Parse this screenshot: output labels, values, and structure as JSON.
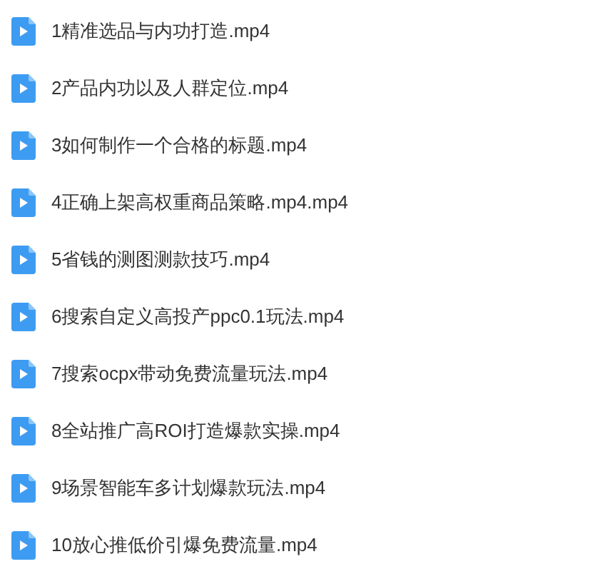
{
  "files": [
    {
      "name": "1精准选品与内功打造.mp4"
    },
    {
      "name": "2产品内功以及人群定位.mp4"
    },
    {
      "name": "3如何制作一个合格的标题.mp4"
    },
    {
      "name": "4正确上架高权重商品策略.mp4.mp4"
    },
    {
      "name": "5省钱的测图测款技巧.mp4"
    },
    {
      "name": "6搜索自定义高投产ppc0.1玩法.mp4"
    },
    {
      "name": "7搜索ocpx带动免费流量玩法.mp4"
    },
    {
      "name": "8全站推广高ROI打造爆款实操.mp4"
    },
    {
      "name": "9场景智能车多计划爆款玩法.mp4"
    },
    {
      "name": "10放心推低价引爆免费流量.mp4"
    }
  ]
}
